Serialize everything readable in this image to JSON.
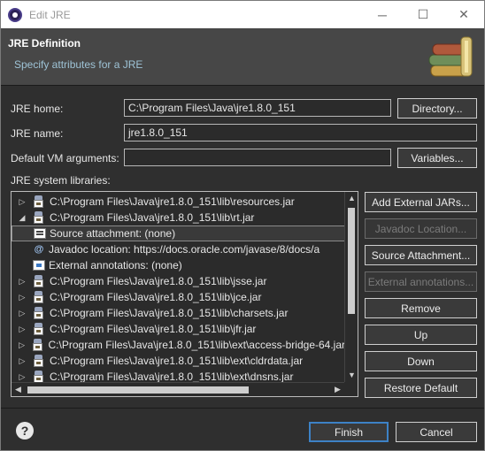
{
  "window": {
    "title": "Edit JRE",
    "minimize": "─",
    "maximize": "☐",
    "close": "✕"
  },
  "header": {
    "title": "JRE Definition",
    "subtitle": "Specify attributes for a JRE"
  },
  "form": {
    "jre_home_label": "JRE home:",
    "jre_home_value": "C:\\Program Files\\Java\\jre1.8.0_151",
    "directory_button": "Directory...",
    "jre_name_label": "JRE name:",
    "jre_name_value": "jre1.8.0_151",
    "vm_args_label": "Default VM arguments:",
    "vm_args_value": "",
    "variables_button": "Variables..."
  },
  "libraries": {
    "label": "JRE system libraries:",
    "items": [
      {
        "type": "jar",
        "expanded": false,
        "text": "C:\\Program Files\\Java\\jre1.8.0_151\\lib\\resources.jar"
      },
      {
        "type": "jar",
        "expanded": true,
        "text": "C:\\Program Files\\Java\\jre1.8.0_151\\lib\\rt.jar"
      },
      {
        "type": "source",
        "text": "Source attachment: (none)"
      },
      {
        "type": "javadoc",
        "text": "Javadoc location: https://docs.oracle.com/javase/8/docs/a"
      },
      {
        "type": "annotations",
        "text": "External annotations: (none)"
      },
      {
        "type": "jar",
        "expanded": false,
        "text": "C:\\Program Files\\Java\\jre1.8.0_151\\lib\\jsse.jar"
      },
      {
        "type": "jar",
        "expanded": false,
        "text": "C:\\Program Files\\Java\\jre1.8.0_151\\lib\\jce.jar"
      },
      {
        "type": "jar",
        "expanded": false,
        "text": "C:\\Program Files\\Java\\jre1.8.0_151\\lib\\charsets.jar"
      },
      {
        "type": "jar",
        "expanded": false,
        "text": "C:\\Program Files\\Java\\jre1.8.0_151\\lib\\jfr.jar"
      },
      {
        "type": "jar",
        "expanded": false,
        "text": "C:\\Program Files\\Java\\jre1.8.0_151\\lib\\ext\\access-bridge-64.jar"
      },
      {
        "type": "jar",
        "expanded": false,
        "text": "C:\\Program Files\\Java\\jre1.8.0_151\\lib\\ext\\cldrdata.jar"
      },
      {
        "type": "jar",
        "expanded": false,
        "text": "C:\\Program Files\\Java\\jre1.8.0_151\\lib\\ext\\dnsns.jar"
      }
    ]
  },
  "side_buttons": {
    "add_external_jars": "Add External JARs...",
    "javadoc_location": "Javadoc Location...",
    "source_attachment": "Source Attachment...",
    "external_annotations": "External annotations...",
    "remove": "Remove",
    "up": "Up",
    "down": "Down",
    "restore_default": "Restore Default"
  },
  "footer": {
    "help": "?",
    "finish": "Finish",
    "cancel": "Cancel"
  }
}
